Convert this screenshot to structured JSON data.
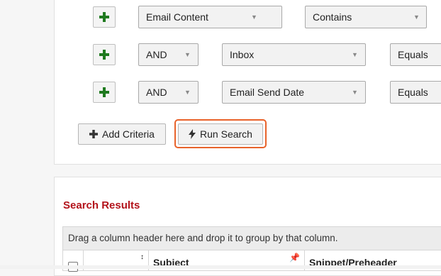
{
  "criteria_rows": [
    {
      "operator": null,
      "field": "Email Content",
      "condition": "Contains"
    },
    {
      "operator": "AND",
      "field": "Inbox",
      "condition": "Equals"
    },
    {
      "operator": "AND",
      "field": "Email Send Date",
      "condition": "Equals"
    }
  ],
  "buttons": {
    "add_criteria": "Add Criteria",
    "run_search": "Run Search"
  },
  "results": {
    "title": "Search Results",
    "group_hint": "Drag a column header here and drop it to group by that column.",
    "columns": [
      "Subject",
      "Snippet/Preheader"
    ]
  },
  "colors": {
    "plus_green": "#1f7a1f",
    "results_title": "#b3131b",
    "highlight": "#e8622a"
  },
  "icons": {
    "add_row": "plus-icon",
    "add_criteria": "plus-icon",
    "run_search": "lightning-icon",
    "column_pin": "pin-icon",
    "sort": "sort-icon",
    "dropdown": "chevron-down-icon"
  }
}
